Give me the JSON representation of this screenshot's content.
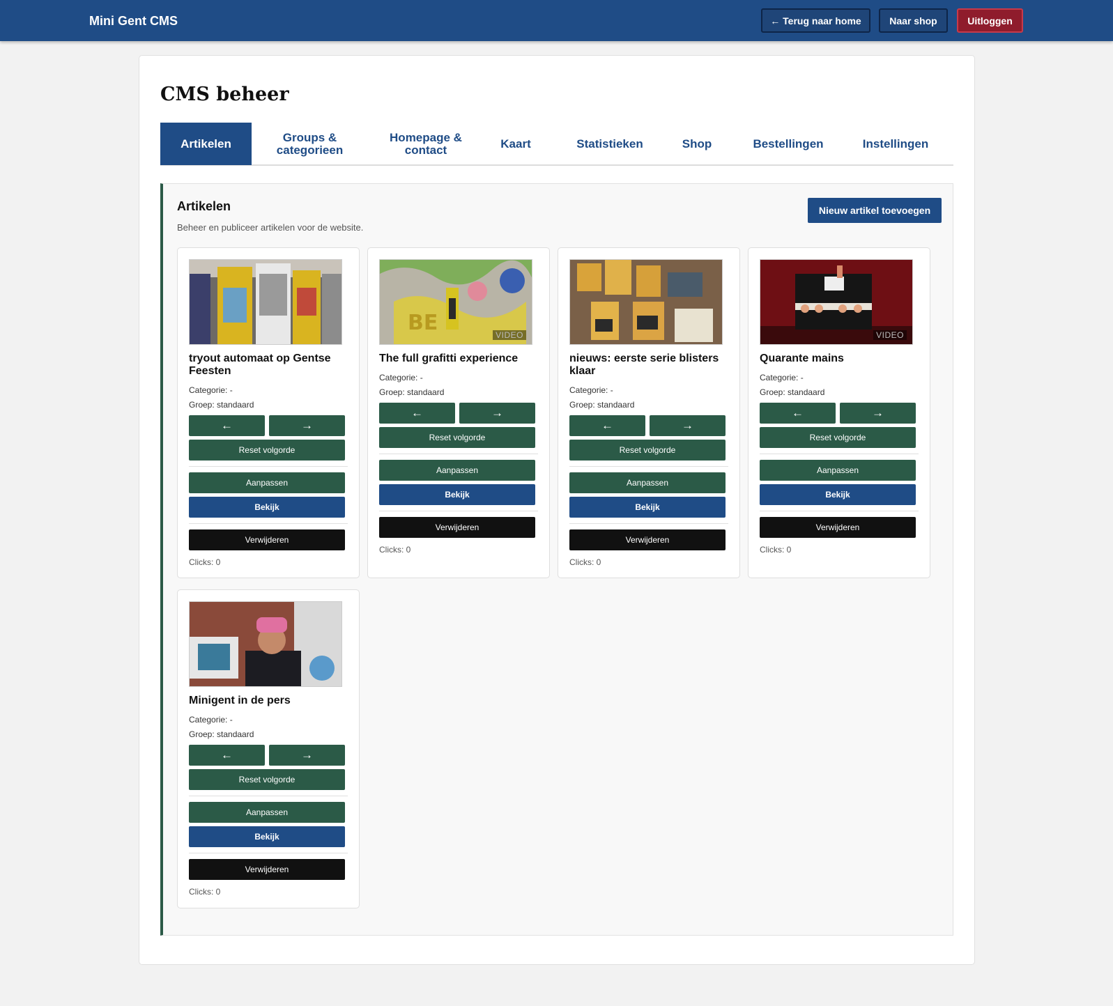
{
  "topbar": {
    "brand": "Mini Gent CMS",
    "home_label": "← Terug naar home",
    "shop_label": "Naar shop",
    "logout_label": "Uitloggen"
  },
  "page": {
    "title": "CMS beheer"
  },
  "tabs": [
    {
      "label": "Artikelen"
    },
    {
      "label": "Groups & categorieen"
    },
    {
      "label": "Homepage & contact"
    },
    {
      "label": "Kaart"
    },
    {
      "label": "Statistieken"
    },
    {
      "label": "Shop"
    },
    {
      "label": "Bestellingen"
    },
    {
      "label": "Instellingen"
    }
  ],
  "section": {
    "title": "Artikelen",
    "subtitle": "Beheer en publiceer artikelen voor de website.",
    "new_button": "Nieuw artikel toevoegen"
  },
  "buttons": {
    "left": "←",
    "right": "→",
    "reset": "Reset volgorde",
    "edit": "Aanpassen",
    "view": "Bekijk",
    "delete": "Verwijderen"
  },
  "articles": [
    {
      "title": "tryout automaat op Gentse Feesten",
      "category": "Categorie: -",
      "group": "Groep: standaard",
      "clicks": "Clicks: 0",
      "video": ""
    },
    {
      "title": "The full grafitti experience",
      "category": "Categorie: -",
      "group": "Groep: standaard",
      "clicks": "Clicks: 0",
      "video": "VIDEO"
    },
    {
      "title": "nieuws: eerste serie blisters klaar",
      "category": "Categorie: -",
      "group": "Groep: standaard",
      "clicks": "Clicks: 0",
      "video": ""
    },
    {
      "title": "Quarante mains",
      "category": "Categorie: -",
      "group": "Groep: standaard",
      "clicks": "Clicks: 0",
      "video": "VIDEO"
    },
    {
      "title": "Minigent in de pers",
      "category": "Categorie: -",
      "group": "Groep: standaard",
      "clicks": "Clicks: 0",
      "video": ""
    }
  ],
  "colors": {
    "header": "#1f4c86",
    "green_button": "#2b5a47",
    "blue_button": "#1f4c86",
    "delete_button": "#111111",
    "logout_button": "#8f1c2c"
  }
}
